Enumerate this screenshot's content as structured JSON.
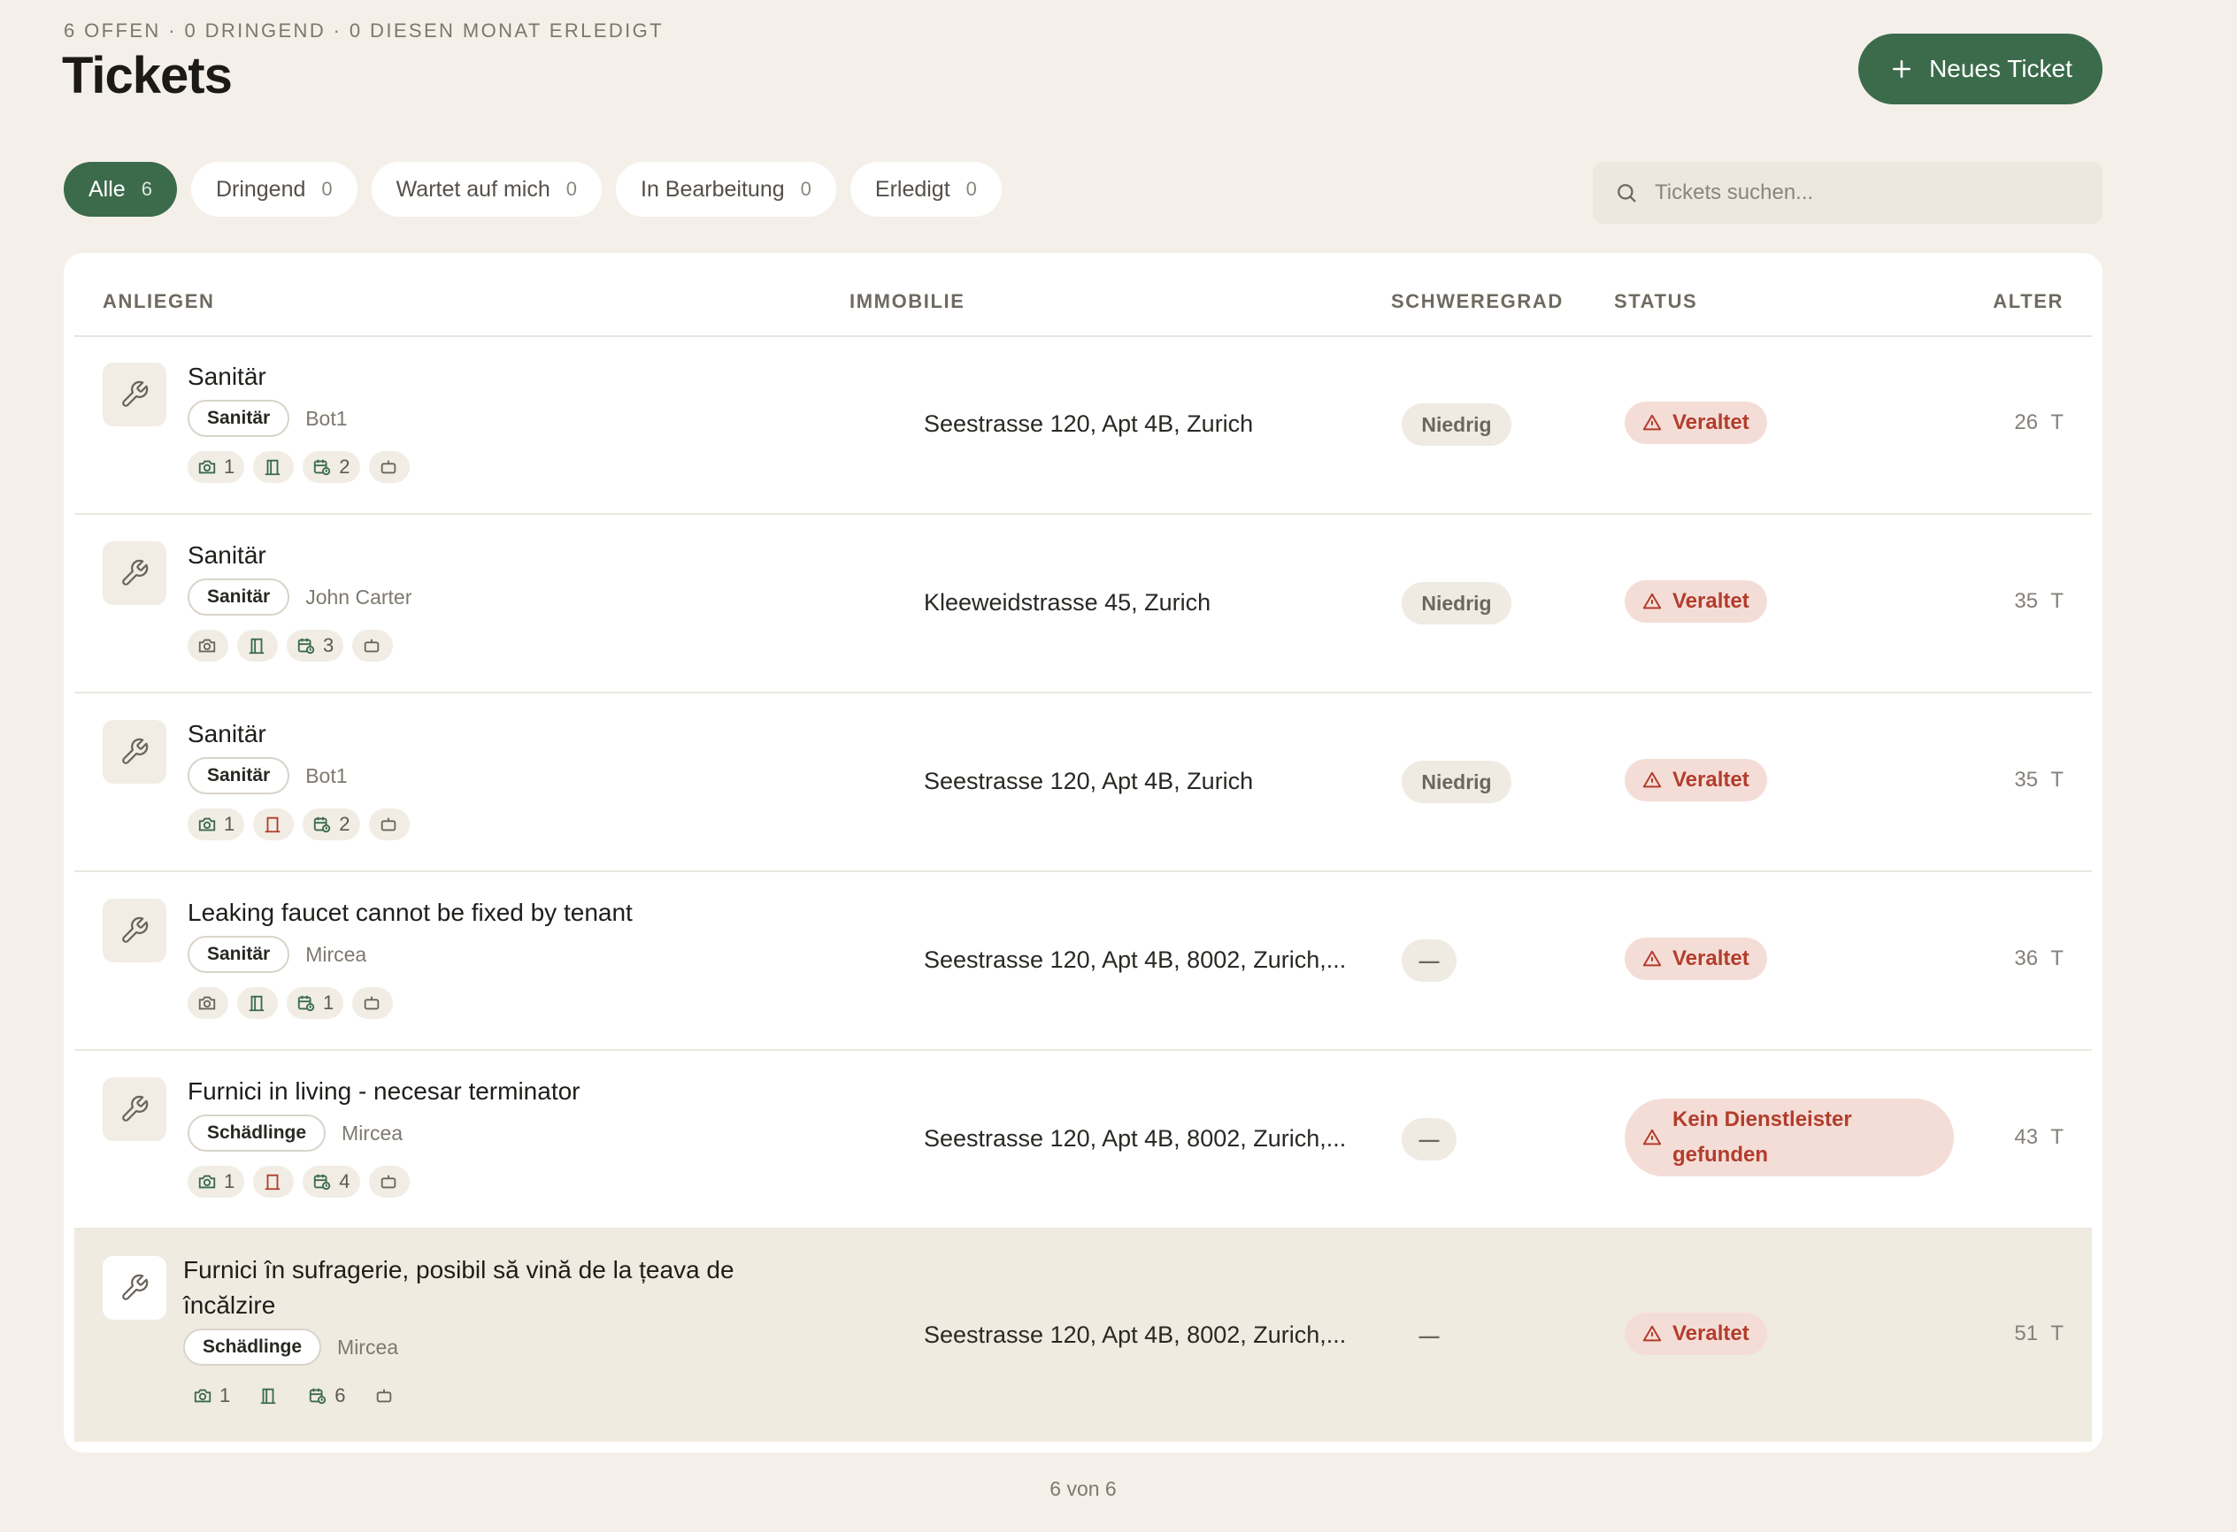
{
  "header": {
    "summary": "6 OFFEN · 0 DRINGEND · 0 DIESEN MONAT ERLEDIGT",
    "title": "Tickets",
    "new_button_label": "Neues Ticket"
  },
  "tabs": [
    {
      "label": "Alle",
      "count": "6",
      "active": true
    },
    {
      "label": "Dringend",
      "count": "0"
    },
    {
      "label": "Wartet auf mich",
      "count": "0"
    },
    {
      "label": "In Bearbeitung",
      "count": "0"
    },
    {
      "label": "Erledigt",
      "count": "0"
    }
  ],
  "search": {
    "placeholder": "Tickets suchen..."
  },
  "table": {
    "columns": [
      "ANLIEGEN",
      "IMMOBILIE",
      "SCHWEREGRAD",
      "STATUS",
      "ALTER"
    ],
    "rows": [
      {
        "title": "Sanitär",
        "category": "Sanitär",
        "person": "Bot1",
        "photos": "1",
        "visits": "2",
        "address": "Seestrasse 120, Apt 4B, Zurich",
        "severity": "Niedrig",
        "status": "Veraltet",
        "age": "26 T"
      },
      {
        "title": "Sanitär",
        "category": "Sanitär",
        "person": "John Carter",
        "photos": "",
        "visits": "3",
        "address": "Kleeweidstrasse 45, Zurich",
        "severity": "Niedrig",
        "status": "Veraltet",
        "age": "35 T"
      },
      {
        "title": "Sanitär",
        "category": "Sanitär",
        "person": "Bot1",
        "photos": "1",
        "visits": "2",
        "address": "Seestrasse 120, Apt 4B, Zurich",
        "severity": "Niedrig",
        "status": "Veraltet",
        "age": "35 T"
      },
      {
        "title": "Leaking faucet cannot be fixed by tenant",
        "category": "Sanitär",
        "person": "Mircea",
        "photos": "",
        "visits": "1",
        "address": "Seestrasse 120, Apt 4B, 8002, Zurich,...",
        "severity": "—",
        "status": "Veraltet",
        "age": "36 T"
      },
      {
        "title": "Furnici in living - necesar terminator",
        "category": "Schädlinge",
        "person": "Mircea",
        "photos": "1",
        "visits": "4",
        "address": "Seestrasse 120, Apt 4B, 8002, Zurich,...",
        "severity": "—",
        "status_line1": "Kein Dienstleister",
        "status_line2": "gefunden",
        "age": "43 T"
      },
      {
        "title_line1": "Furnici în sufragerie, posibil să vină de la țeava de",
        "title_line2": "încălzire",
        "category": "Schädlinge",
        "person": "Mircea",
        "photos": "1",
        "visits": "6",
        "address": "Seestrasse 120, Apt 4B, 8002, Zurich,...",
        "severity": "—",
        "status": "Veraltet",
        "age": "51 T"
      }
    ]
  },
  "footer": {
    "count_text": "6 von 6"
  },
  "colors": {
    "accent": "#3b6b4b",
    "danger": "#b23d2c",
    "danger_bg": "#f5ddd7",
    "background": "#f4f0e9"
  }
}
